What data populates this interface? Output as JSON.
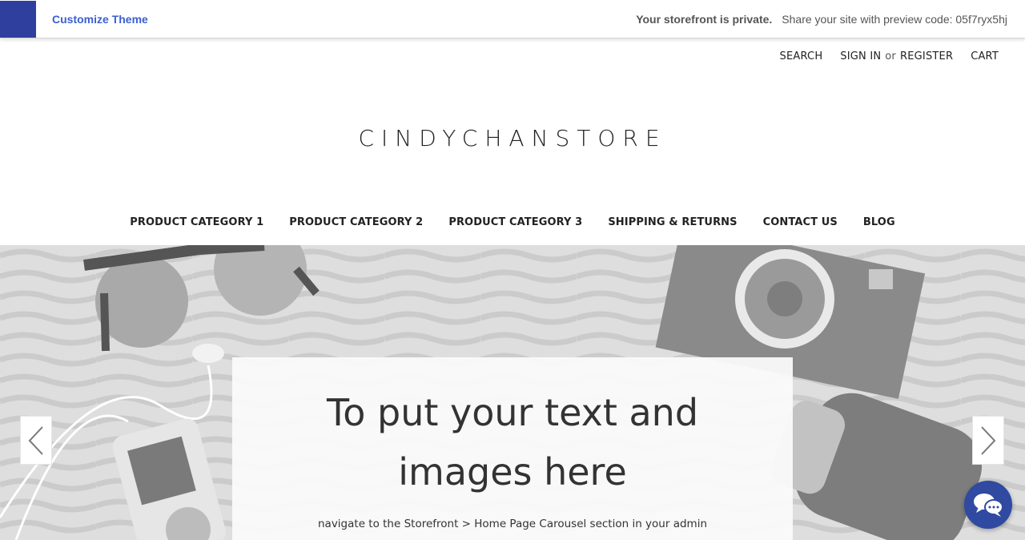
{
  "preview_bar": {
    "customize_label": "Customize Theme",
    "private_label": "Your storefront is private.",
    "share_text": "Share your site with preview code: 05f7ryx5hj",
    "accent_color": "#2f3f9e"
  },
  "utility_nav": {
    "search": "SEARCH",
    "sign_in": "SIGN IN",
    "or": "or",
    "register": "REGISTER",
    "cart": "CART"
  },
  "logo": {
    "text": "CINDYCHANSTORE"
  },
  "main_nav": {
    "items": [
      "PRODUCT CATEGORY 1",
      "PRODUCT CATEGORY 2",
      "PRODUCT CATEGORY 3",
      "SHIPPING & RETURNS",
      "CONTACT US",
      "BLOG"
    ]
  },
  "hero": {
    "heading_line1": "To put your text and",
    "heading_line2": "images here",
    "subtext": "navigate to the Storefront > Home Page Carousel section in your admin",
    "prev_icon": "chevron-left-icon",
    "next_icon": "chevron-right-icon"
  },
  "chat": {
    "icon": "chat-bubbles-icon",
    "color": "#2f4aa0"
  }
}
